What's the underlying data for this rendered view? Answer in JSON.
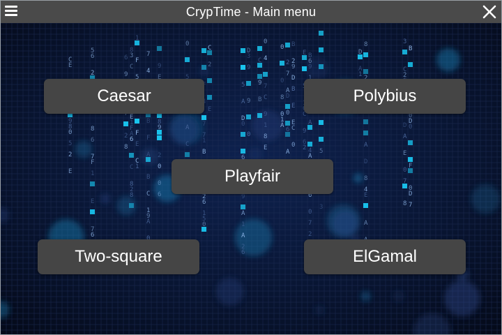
{
  "window": {
    "title": "CrypTime - Main menu"
  },
  "titlebar": {
    "menu_icon": "hamburger-icon",
    "close_icon": "close-icon"
  },
  "menu": {
    "buttons": [
      {
        "label": "Caesar"
      },
      {
        "label": "Polybius"
      },
      {
        "label": "Playfair"
      },
      {
        "label": "Two-square"
      },
      {
        "label": "ElGamal"
      }
    ]
  },
  "colors": {
    "titlebar": "#4a4a4a",
    "button": "#454545",
    "background": "#050b1e",
    "glow": "#19c6f0"
  }
}
